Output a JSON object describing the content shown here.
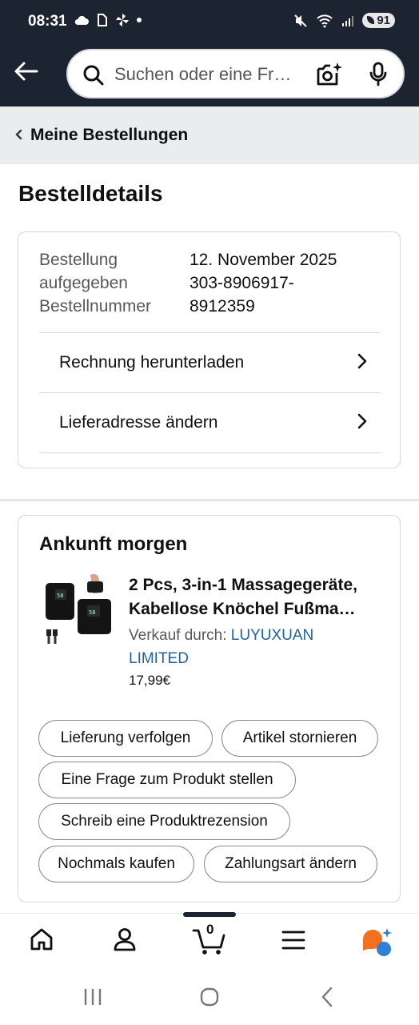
{
  "status_bar": {
    "time": "08:31",
    "battery": "91",
    "left_icons": [
      "cloud-icon",
      "app-icon",
      "fan-icon",
      "dot-icon"
    ],
    "right_icons": [
      "mute-icon",
      "wifi-icon",
      "signal-icon",
      "battery-icon"
    ]
  },
  "header": {
    "search_placeholder": "Suchen oder eine Fr…"
  },
  "breadcrumb": {
    "label": "Meine Bestellungen"
  },
  "page": {
    "title": "Bestelldetails"
  },
  "order": {
    "date_label_1": "Bestellung",
    "date_label_2": "aufgegeben",
    "date_value": "12. November 2025",
    "number_label": "Bestellnummer",
    "number_value_1": "303-8906917-",
    "number_value_2": "8912359",
    "rows": [
      {
        "label": "Rechnung herunterladen"
      },
      {
        "label": "Lieferadresse ändern"
      }
    ]
  },
  "shipment": {
    "title": "Ankunft morgen",
    "product_title_1": "2 Pcs, 3-in-1 Massagegeräte,",
    "product_title_2": "Kabellose Knöchel Fußma…",
    "seller_prefix": "Verkauf durch: ",
    "seller_1": "LUYUXUAN",
    "seller_2": "LIMITED",
    "price": "17,99€",
    "buttons": [
      {
        "label": "Lieferung verfolgen"
      },
      {
        "label": "Artikel stornieren"
      },
      {
        "label": "Eine Frage zum Produkt stellen"
      },
      {
        "label": "Schreib eine Produktrezension"
      },
      {
        "label": "Nochmals kaufen"
      },
      {
        "label": "Zahlungsart ändern"
      }
    ]
  },
  "bottom_nav": {
    "cart_count": "0",
    "items": [
      "home-icon",
      "account-icon",
      "cart-icon",
      "menu-icon",
      "rufus-icon"
    ]
  },
  "colors": {
    "header_bg": "#1c2431",
    "link": "#2162a1",
    "breadcrumb_bg": "#eaeded"
  }
}
